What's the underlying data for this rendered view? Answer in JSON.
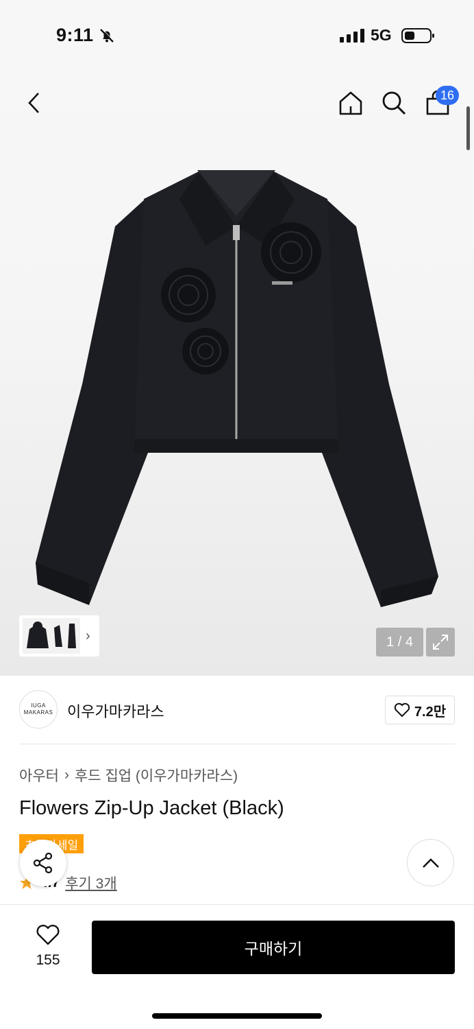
{
  "status_bar": {
    "time": "9:11",
    "network": "5G"
  },
  "header": {
    "cart_count": "16"
  },
  "gallery": {
    "pager": "1 / 4"
  },
  "brand": {
    "logo_line1": "IUGA",
    "logo_line2": "MAKARAS",
    "name": "이우가마카라스",
    "likes": "7.2만"
  },
  "product": {
    "breadcrumb_category": "아우터",
    "breadcrumb_sub": "후드 집업 (이우가마카라스)",
    "title": "Flowers Zip-Up Jacket (Black)",
    "sale_badge": "초특가세일",
    "rating": "4.7",
    "reviews": "후기 3개"
  },
  "bottom": {
    "wish_count": "155",
    "buy_label": "구매하기"
  },
  "colors": {
    "accent_blue": "#2f6ef2",
    "sale_orange": "#ff9f0a",
    "star": "#f5a623",
    "buy_black": "#000000"
  }
}
